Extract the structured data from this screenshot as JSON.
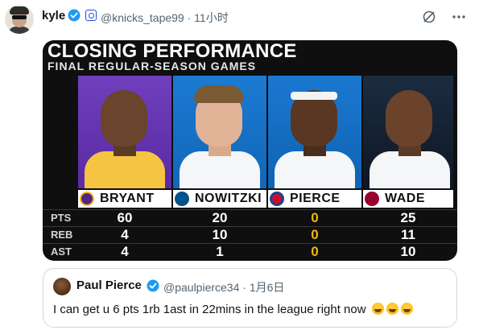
{
  "tweet": {
    "author_name": "kyle",
    "author_handle_meta": "@knicks_tape99 · 11小时",
    "icons": {
      "verified": "verified-badge-icon",
      "subscription": "subscription-badge-icon",
      "grok": "grok-icon",
      "more": "more-options-icon"
    }
  },
  "graphic": {
    "title": "CLOSING PERFORMANCE",
    "subtitle": "FINAL REGULAR-SEASON GAMES",
    "stat_labels": [
      "PTS",
      "REB",
      "AST"
    ],
    "players": [
      {
        "name": "BRYANT",
        "pts": "60",
        "reb": "4",
        "ast": "4"
      },
      {
        "name": "NOWITZKI",
        "pts": "20",
        "reb": "10",
        "ast": "1"
      },
      {
        "name": "PIERCE",
        "pts": "0",
        "reb": "0",
        "ast": "0"
      },
      {
        "name": "WADE",
        "pts": "25",
        "reb": "11",
        "ast": "10"
      }
    ],
    "colors": {
      "lakers": "#5b2aa3",
      "mavericks": "#1167b9",
      "clippers": "#0f63b3",
      "heat": "#0e1724",
      "highlight": "#f2b705"
    }
  },
  "quoted_tweet": {
    "author_name": "Paul Pierce",
    "author_handle_meta": "@paulpierce34 · 1月6日",
    "text": "I can get u 6 pts 1rb 1ast in 22mins in the league right now"
  }
}
